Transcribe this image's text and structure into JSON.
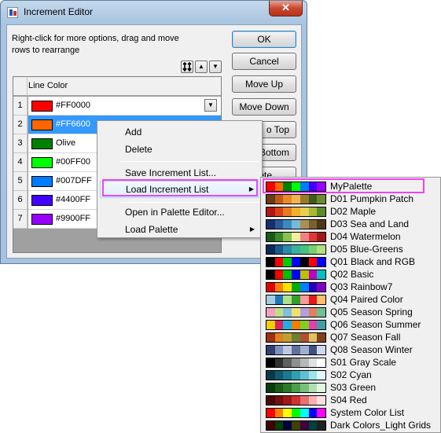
{
  "window": {
    "title": "Increment Editor",
    "close_glyph": "✕"
  },
  "hint": "Right-click for more options, drag and move rows to  rearrange",
  "buttons": {
    "ok": "OK",
    "cancel": "Cancel",
    "move_up": "Move Up",
    "move_down": "Move Down",
    "move_to_top_partial": "o Top",
    "move_to_bottom_partial": "Bottom",
    "delete_partial": "ete"
  },
  "grid": {
    "column": "Line Color",
    "rows": [
      {
        "num": "1",
        "color": "#FF0000",
        "text": "#FF0000"
      },
      {
        "num": "2",
        "color": "#FF6600",
        "text": "#FF6600"
      },
      {
        "num": "3",
        "color": "#008000",
        "text": "Olive"
      },
      {
        "num": "4",
        "color": "#00FF00",
        "text": "#00FF00"
      },
      {
        "num": "5",
        "color": "#007DFF",
        "text": "#007DFF"
      },
      {
        "num": "6",
        "color": "#4400FF",
        "text": "#4400FF"
      },
      {
        "num": "7",
        "color": "#9900FF",
        "text": "#9900FF"
      }
    ]
  },
  "context_menu": {
    "items": [
      {
        "label": "Add"
      },
      {
        "label": "Delete"
      },
      {
        "label": "Save Increment List..."
      },
      {
        "label": "Load Increment List"
      },
      {
        "label": "Open in Palette Editor..."
      },
      {
        "label": "Load Palette"
      }
    ],
    "highlight": "#ee44ee"
  },
  "palettes": [
    {
      "name": "MyPalette",
      "colors": [
        "#ff0000",
        "#ff6600",
        "#008000",
        "#00ff00",
        "#007dff",
        "#4400ff",
        "#9900ff"
      ]
    },
    {
      "name": "D01 Pumpkin Patch",
      "colors": [
        "#6b3a16",
        "#c05a1a",
        "#e88a2a",
        "#f2b450",
        "#9a7a2a",
        "#3e5a1e",
        "#6e8a2e"
      ]
    },
    {
      "name": "D02 Maple",
      "colors": [
        "#b01818",
        "#d84018",
        "#e87a20",
        "#f0b030",
        "#e8d050",
        "#a8b838",
        "#5a8a2a"
      ]
    },
    {
      "name": "D03 Sea and Land",
      "colors": [
        "#1a2e6b",
        "#2a5a9a",
        "#3a8ac0",
        "#7ab8d8",
        "#a89058",
        "#7a6030",
        "#4a3818"
      ]
    },
    {
      "name": "D04 Watermelon",
      "colors": [
        "#1a5a1a",
        "#3a8a2a",
        "#8ac050",
        "#f0f0a0",
        "#f08080",
        "#e03838",
        "#a01818"
      ]
    },
    {
      "name": "D05 Blue-Greens",
      "colors": [
        "#0a2a5a",
        "#1a5a8a",
        "#2a8aaa",
        "#3ab0a0",
        "#4ac080",
        "#7ad070",
        "#b0e080"
      ]
    },
    {
      "name": "Q01 Black and RGB",
      "colors": [
        "#000000",
        "#ff0000",
        "#00cc00",
        "#0000ff",
        "#000000",
        "#ff0000",
        "#0000ff"
      ]
    },
    {
      "name": "Q02 Basic",
      "colors": [
        "#000000",
        "#ff0000",
        "#00c000",
        "#0000ff",
        "#c0c000",
        "#c000c0",
        "#00c0c0"
      ]
    },
    {
      "name": "Q03 Rainbow7",
      "colors": [
        "#e00000",
        "#ff8000",
        "#ffe000",
        "#00b000",
        "#0080ff",
        "#2000c0",
        "#8000c0"
      ]
    },
    {
      "name": "Q04 Paired Color",
      "colors": [
        "#a6cee3",
        "#1f78b4",
        "#b2df8a",
        "#33a02c",
        "#fb9a99",
        "#e31a1c",
        "#fdbf6f"
      ]
    },
    {
      "name": "Q05 Season Spring",
      "colors": [
        "#f4a0c0",
        "#c0e080",
        "#80c0e0",
        "#f0e070",
        "#b0a0e0",
        "#e08060",
        "#70c090"
      ]
    },
    {
      "name": "Q06 Season Summer",
      "colors": [
        "#f0d000",
        "#e02060",
        "#20b0e0",
        "#f08000",
        "#80d020",
        "#e040b0",
        "#40a0a0"
      ]
    },
    {
      "name": "Q07 Season Fall",
      "colors": [
        "#a03010",
        "#e08020",
        "#c0a030",
        "#708030",
        "#b05030",
        "#e0c060",
        "#804020"
      ]
    },
    {
      "name": "Q08 Season Winter",
      "colors": [
        "#304070",
        "#8090c0",
        "#c0c8e0",
        "#6070a0",
        "#a0b0d0",
        "#405080",
        "#d0d8f0"
      ]
    },
    {
      "name": "S01 Gray Scale",
      "colors": [
        "#000000",
        "#303030",
        "#606060",
        "#909090",
        "#b8b8b8",
        "#e0e0e0",
        "#ffffff"
      ]
    },
    {
      "name": "S02 Cyan",
      "colors": [
        "#0a3a4a",
        "#105a70",
        "#1a7a90",
        "#30a0b0",
        "#60c0d0",
        "#a0e0e8",
        "#e0f8f8"
      ]
    },
    {
      "name": "S03 Green",
      "colors": [
        "#0a3a0a",
        "#1a5a1a",
        "#2a7a2a",
        "#4aa04a",
        "#7ac07a",
        "#b0e0b0",
        "#e0f8e0"
      ]
    },
    {
      "name": "S04 Red",
      "colors": [
        "#4a0808",
        "#701010",
        "#a01818",
        "#d03030",
        "#e87070",
        "#f8b0b0",
        "#fce0e0"
      ]
    },
    {
      "name": "System Color List",
      "colors": [
        "#ff0000",
        "#ff8000",
        "#ffff00",
        "#00ff00",
        "#00ffff",
        "#0000ff",
        "#ff00ff"
      ]
    },
    {
      "name": "Dark Colors_Light Grids",
      "colors": [
        "#400000",
        "#004000",
        "#000040",
        "#404000",
        "#400040",
        "#004040",
        "#202020"
      ]
    }
  ]
}
